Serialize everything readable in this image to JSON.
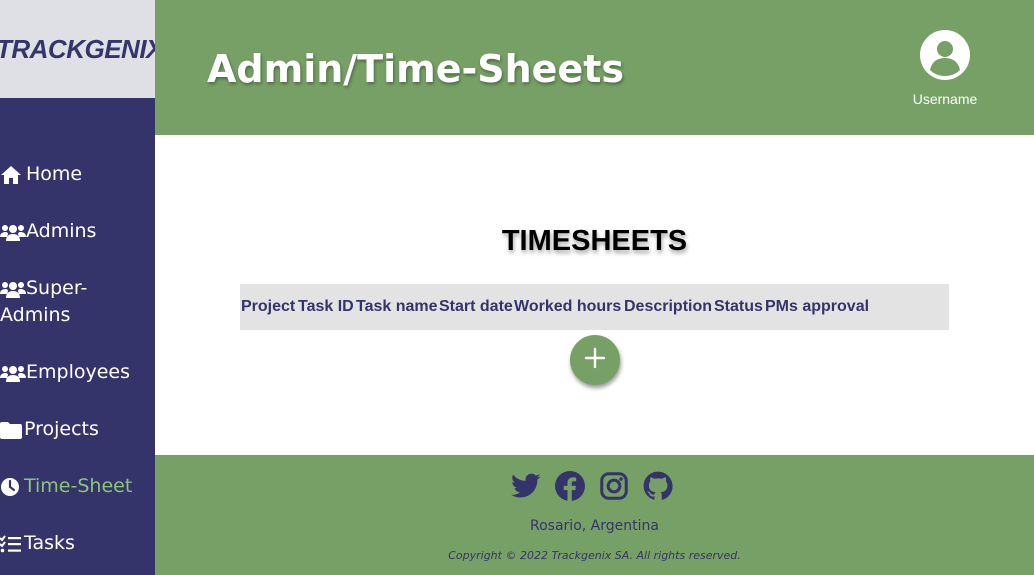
{
  "logo": "TRACKGENIX",
  "header": {
    "title": "Admin/Time-Sheets",
    "username": "Username",
    "user_icon": "user-circle-icon"
  },
  "sidebar": {
    "items": [
      {
        "label": "Home",
        "icon": "home-icon",
        "active": false
      },
      {
        "label": "Admins",
        "icon": "users-icon",
        "active": false
      },
      {
        "label": "Super-Admins",
        "icon": "users-icon",
        "active": false
      },
      {
        "label": "Employees",
        "icon": "users-icon",
        "active": false
      },
      {
        "label": "Projects",
        "icon": "folder-icon",
        "active": false
      },
      {
        "label": "Time-Sheet",
        "icon": "clock-icon",
        "active": true
      },
      {
        "label": "Tasks",
        "icon": "tasks-icon",
        "active": false
      }
    ]
  },
  "main": {
    "section_title": "TIMESHEETS",
    "table_columns": [
      "Project",
      "Task ID",
      "Task name",
      "Start date",
      "Worked hours",
      "Description",
      "Status",
      "PMs approval"
    ],
    "add_button_icon": "plus-icon"
  },
  "footer": {
    "socials": [
      "twitter-icon",
      "facebook-icon",
      "instagram-icon",
      "github-icon"
    ],
    "location": "Rosario, Argentina",
    "copyright": "Copyright © 2022 Trackgenix SA. All rights reserved."
  },
  "colors": {
    "header_green": "#77a066",
    "sidebar_navy": "#35346a",
    "active_green": "#8cc47a",
    "logo_bg": "#dfdfe6",
    "table_bg": "#e3e3e3"
  }
}
